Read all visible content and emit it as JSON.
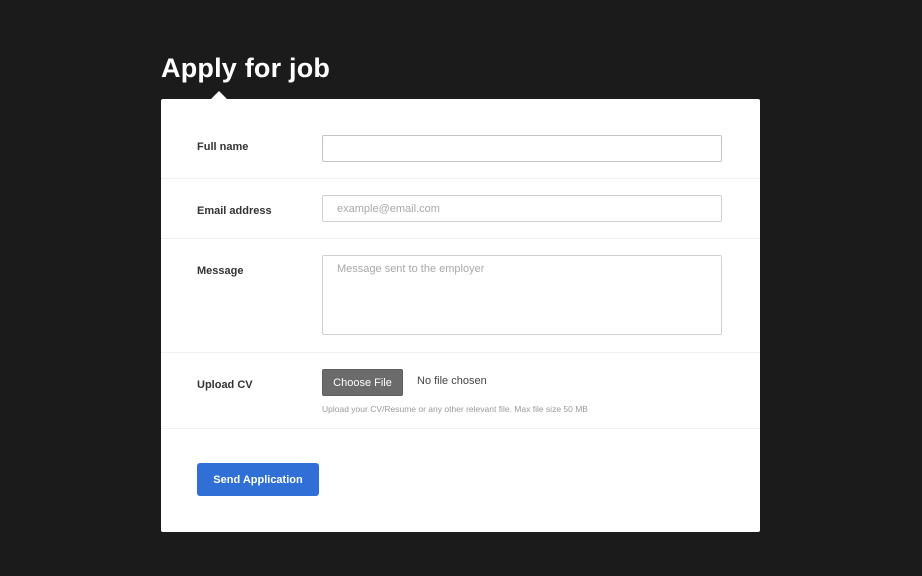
{
  "page": {
    "title": "Apply for job"
  },
  "form": {
    "full_name": {
      "label": "Full name",
      "value": "",
      "placeholder": ""
    },
    "email": {
      "label": "Email address",
      "value": "",
      "placeholder": "example@email.com"
    },
    "message": {
      "label": "Message",
      "value": "",
      "placeholder": "Message sent to the employer"
    },
    "upload": {
      "label": "Upload CV",
      "button_label": "Choose File",
      "status": "No file chosen",
      "help": "Upload your CV/Resume or any other relevant file. Max file size 50 MB"
    },
    "submit_label": "Send Application"
  },
  "colors": {
    "background": "#1b1b1b",
    "card": "#ffffff",
    "primary_button": "#2f6fd6",
    "file_button": "#6b6b6b"
  }
}
